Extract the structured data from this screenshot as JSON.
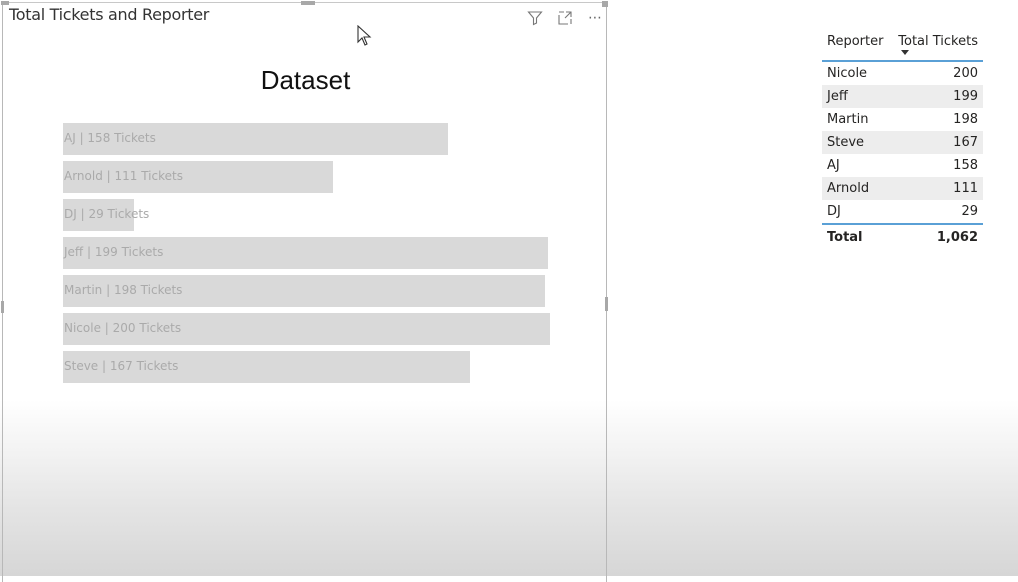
{
  "visual": {
    "title": "Total Tickets and Reporter",
    "icons": [
      "filter-icon",
      "focus-mode-icon",
      "more-options-icon"
    ],
    "more_label": "⋯"
  },
  "chart_data": {
    "type": "bar",
    "orientation": "horizontal",
    "title": "Dataset",
    "categories": [
      "AJ",
      "Arnold",
      "DJ",
      "Jeff",
      "Martin",
      "Nicole",
      "Steve"
    ],
    "values": [
      158,
      111,
      29,
      199,
      198,
      200,
      167
    ],
    "labels": [
      "AJ | 158 Tickets",
      "Arnold | 111 Tickets",
      "DJ | 29 Tickets",
      "Jeff | 199 Tickets",
      "Martin | 198 Tickets",
      "Nicole | 200 Tickets",
      "Steve | 167 Tickets"
    ],
    "xlabel": "",
    "ylabel": "",
    "xlim": [
      0,
      200
    ],
    "grid": false,
    "bar_color": "#d9d9d9",
    "label_color": "#aaaaaa"
  },
  "table": {
    "headers": [
      "Reporter",
      "Total Tickets"
    ],
    "sort_column": "Total Tickets",
    "sort_direction": "descending",
    "rows": [
      {
        "reporter": "Nicole",
        "total": "200"
      },
      {
        "reporter": "Jeff",
        "total": "199"
      },
      {
        "reporter": "Martin",
        "total": "198"
      },
      {
        "reporter": "Steve",
        "total": "167"
      },
      {
        "reporter": "AJ",
        "total": "158"
      },
      {
        "reporter": "Arnold",
        "total": "111"
      },
      {
        "reporter": "DJ",
        "total": "29"
      }
    ],
    "total_label": "Total",
    "total_value": "1,062",
    "accent_color": "#5aa0d6"
  }
}
